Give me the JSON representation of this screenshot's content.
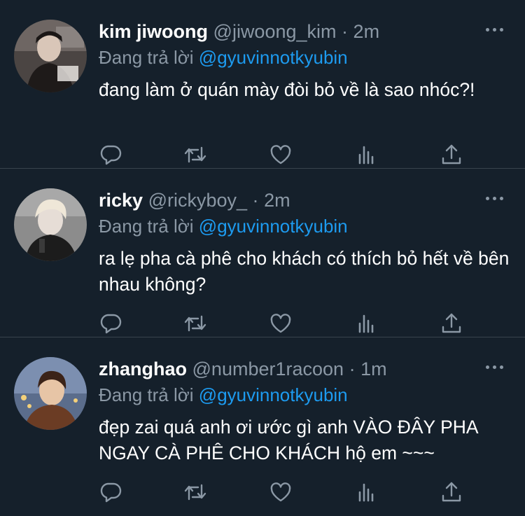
{
  "colors": {
    "background": "#15202b",
    "divider": "#38444d",
    "muted": "#8b98a5",
    "link": "#1d9bf0",
    "text": "#ffffff"
  },
  "icons": [
    "reply-icon",
    "retweet-icon",
    "like-icon",
    "analytics-icon",
    "share-icon",
    "more-icon"
  ],
  "tweets": [
    {
      "name": "kim jiwoong",
      "handle": "@jiwoong_kim",
      "sep": "·",
      "time": "2m",
      "reply_prefix": "Đang trả lời",
      "reply_handle": "@gyuvinnotkyubin",
      "text": "đang làm ở quán mày đòi bỏ về là sao nhóc?!"
    },
    {
      "name": "ricky",
      "handle": "@rickyboy_",
      "sep": "·",
      "time": "2m",
      "reply_prefix": "Đang trả lời",
      "reply_handle": "@gyuvinnotkyubin",
      "text": "ra lẹ pha cà phê cho khách có thích bỏ hết về bên nhau không?"
    },
    {
      "name": "zhanghao",
      "handle": "@number1racoon",
      "sep": "·",
      "time": "1m",
      "reply_prefix": "Đang trả lời",
      "reply_handle": "@gyuvinnotkyubin",
      "text": "đẹp zai quá anh ơi ước gì anh VÀO ĐÂY PHA NGAY CÀ PHÊ CHO KHÁCH hộ em ~~~"
    }
  ]
}
